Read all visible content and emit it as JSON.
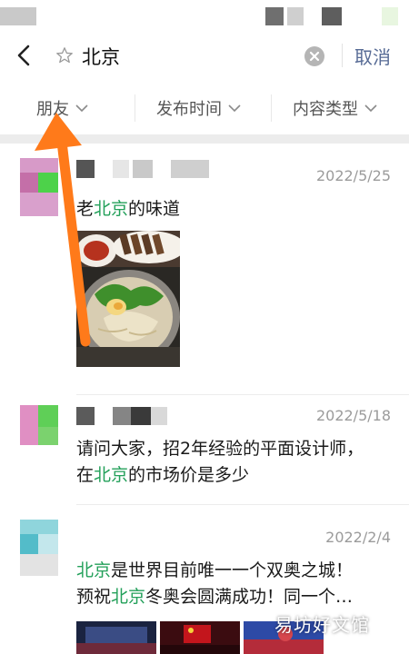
{
  "search": {
    "query": "北京",
    "cancel_label": "取消"
  },
  "filters": [
    {
      "label": "朋友"
    },
    {
      "label": "发布时间"
    },
    {
      "label": "内容类型"
    }
  ],
  "posts": [
    {
      "date": "2022/5/25",
      "text_parts": [
        "老",
        "北京",
        "的味道"
      ]
    },
    {
      "date": "2022/5/18",
      "line1": "请问大家，招2年经验的平面设计师，",
      "line2_parts": [
        "在",
        "北京",
        "的市场价是多少"
      ]
    },
    {
      "date": "2022/2/4",
      "line1_parts": [
        "北京",
        "是世界目前唯一一个双奥之城！"
      ],
      "line2_parts": [
        "预祝",
        "北京",
        "冬奥会圆满成功！同一个…"
      ]
    }
  ],
  "watermark": "易坊好文馆",
  "colors": {
    "keyword": "#23a05a",
    "cancel": "#576b95",
    "arrow": "#ff7a1a",
    "date": "#9b9b9b"
  },
  "icons": {
    "back": "chevron-left-icon",
    "star": "star-outline-icon",
    "clear": "clear-circle-icon",
    "filter_chevron": "chevron-down-icon"
  }
}
